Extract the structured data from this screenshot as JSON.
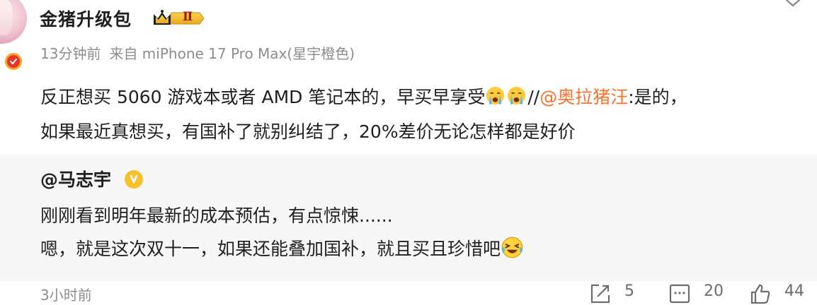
{
  "post": {
    "author": {
      "name": "金猪升级包",
      "level_badge": "Ⅱ",
      "avatar_icon": "avatar",
      "verified_icon": "verified-badge-icon"
    },
    "meta": {
      "time": "13分钟前",
      "source": "来自 miPhone 17 Pro Max(星宇橙色)"
    },
    "text": {
      "line1_part1": "反正想买 5060 游戏本或者 AMD 笔记本的，早买早享受",
      "emoji1": "crying-face-icon",
      "emoji2": "crying-face-icon",
      "repost_sep": "//",
      "mention": "@奥拉猪汪",
      "line1_part2": ":是的，",
      "line2": "如果最近真想买，有国补了就别纠结了，20%差价无论怎样都是好价"
    }
  },
  "quote": {
    "author": "@马志宇",
    "line1": "刚刚看到明年最新的成本预估，有点惊悚......",
    "line2": "嗯，就是这次双十一，如果还能叠加国补，就且买且珍惜吧",
    "emoji": "laughing-crying-icon"
  },
  "footer": {
    "time": "3小时前",
    "repost_count": "5",
    "comment_count": "20",
    "like_count": "44"
  },
  "colors": {
    "accent_mention": "#f7722a",
    "meta_gray": "#8d8d8d",
    "quote_bg": "#f7f7f7",
    "badge_gold": "#f5c22b",
    "verified_red": "#e8332a"
  }
}
